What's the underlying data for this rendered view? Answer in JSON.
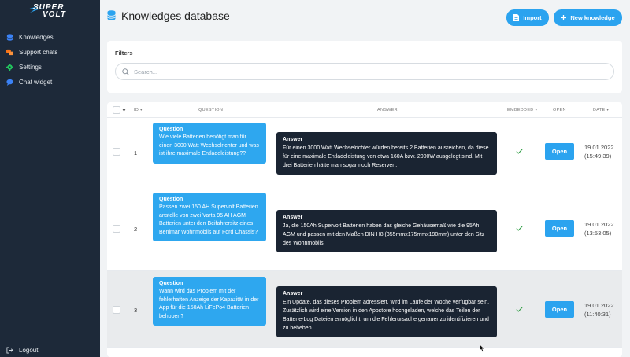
{
  "app": {
    "logo_top": "SUPER",
    "logo_bottom": "VOLT"
  },
  "sidebar": {
    "items": [
      {
        "label": "Knowledges",
        "icon": "database-icon"
      },
      {
        "label": "Support chats",
        "icon": "chat-bubbles-icon"
      },
      {
        "label": "Settings",
        "icon": "gear-icon"
      },
      {
        "label": "Chat widget",
        "icon": "chat-bubble-icon"
      }
    ],
    "logout_label": "Logout"
  },
  "header": {
    "title": "Knowledges database",
    "import_label": "Import",
    "new_label": "New knowledge"
  },
  "filters": {
    "title": "Filters",
    "search_placeholder": "Search..."
  },
  "table": {
    "columns": {
      "id": "ID",
      "question": "QUESTION",
      "answer": "ANSWER",
      "embedded": "EMBEDDED",
      "open": "OPEN",
      "date": "DATE"
    },
    "question_title": "Question",
    "answer_title": "Answer",
    "open_label": "Open",
    "rows": [
      {
        "id": "1",
        "question": "Wie viele Batterien benötigt man für einen 3000 Watt Wechselrichter und was ist ihre maximale Entladeleistung??",
        "answer": "Für einen 3000 Watt Wechselrichter würden bereits 2 Batterien ausreichen, da diese für eine maximale Entladeleistung von etwa 160A bzw. 2000W ausgelegt sind. Mit drei Batterien hätte man sogar noch Reserven.",
        "embedded": true,
        "date": "19.01.2022",
        "time": "(15:49:39)"
      },
      {
        "id": "2",
        "question": "Passen zwei 150 AH Supervolt Batterien anstelle von zwei Varta 95 AH AGM Batterien unter den Beifahrersitz eines Benimar Wohnmobils auf Ford Chassis?",
        "answer": "Ja, die 150Ah Supervolt Batterien haben das gleiche Gehäusemaß wie die 95Ah AGM und passen mit den Maßen DIN H8 (355mmx175mmx190mm) unter den Sitz des Wohnmobils.",
        "embedded": true,
        "date": "19.01.2022",
        "time": "(13:53:05)"
      },
      {
        "id": "3",
        "question": "Wann wird das Problem mit der fehlerhaften Anzeige der Kapazität in der App für die 150Ah LiFePo4 Batterien behoben?",
        "answer": "Ein Update, das dieses Problem adressiert, wird im Laufe der Woche verfügbar sein. Zusätzlich wird eine Version in den Appstore hochgeladen, welche das Teilen der Batterie-Log Dateien ermöglicht, um die Fehlerursache genauer zu identifizieren und zu beheben.",
        "embedded": true,
        "date": "19.01.2022",
        "time": "(11:40:31)"
      }
    ]
  },
  "colors": {
    "sidebar": "#1d2939",
    "accent": "#2ba3ef",
    "answer_box": "#1a2432",
    "check": "#2f9e44"
  }
}
